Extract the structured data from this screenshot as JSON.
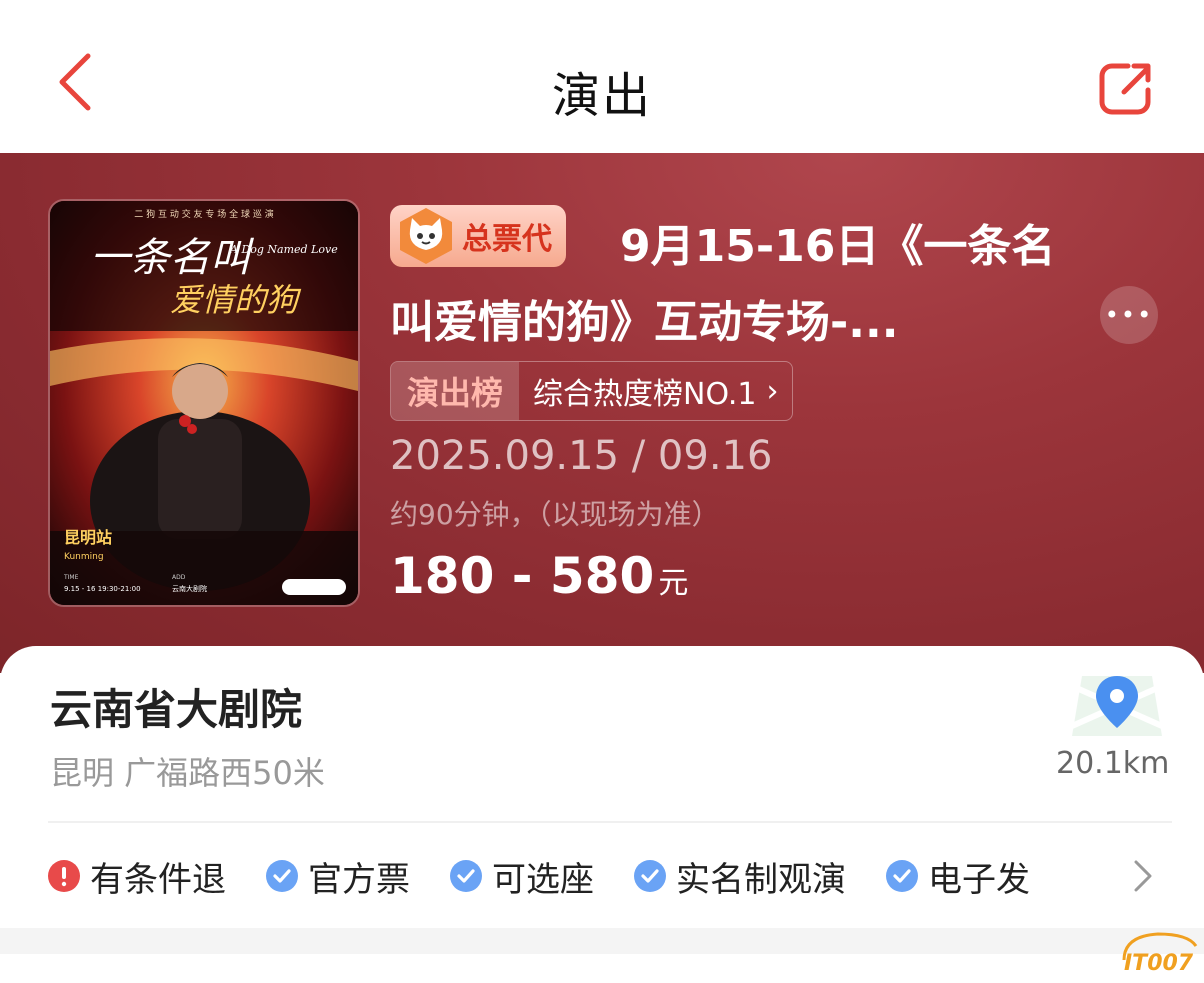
{
  "nav": {
    "title": "演出"
  },
  "poster": {
    "top_line": "二 狗 互 动 交 友 专 场 全 球 巡 演",
    "calligraphy_line1": "一条名叫",
    "calligraphy_line2": "爱情的狗",
    "english_title": "A Dog Named Love",
    "city_cn": "昆明站",
    "city_en": "Kunming",
    "time_label": "TIME",
    "time_value": "9.15 - 16  19:30-21:00",
    "add_label": "ADD",
    "add_value": "云南大剧院"
  },
  "show": {
    "badge": "总票代",
    "title": "9月15-16日《一条名叫爱情的狗》互动专场-...",
    "rank_tag": "演出榜",
    "rank_text": "综合热度榜NO.1",
    "date": "2025.09.15 / 09.16",
    "duration": "约90分钟，（以现场为准）",
    "price": "180 - 580",
    "price_unit": "元"
  },
  "venue": {
    "name": "云南省大剧院",
    "address": "昆明 广福路西50米",
    "distance": "20.1km"
  },
  "tags": [
    {
      "label": "有条件退",
      "icon": "exclamation-icon",
      "color": "#e84a4a"
    },
    {
      "label": "官方票",
      "icon": "check-icon",
      "color": "#6aa3f5"
    },
    {
      "label": "可选座",
      "icon": "check-icon",
      "color": "#6aa3f5"
    },
    {
      "label": "实名制观演",
      "icon": "check-icon",
      "color": "#6aa3f5"
    },
    {
      "label": "电子发",
      "icon": "check-icon",
      "color": "#6aa3f5"
    }
  ],
  "watermark": "IT007",
  "colors": {
    "accent": "#e8453c",
    "hero": "#8f2e34"
  }
}
